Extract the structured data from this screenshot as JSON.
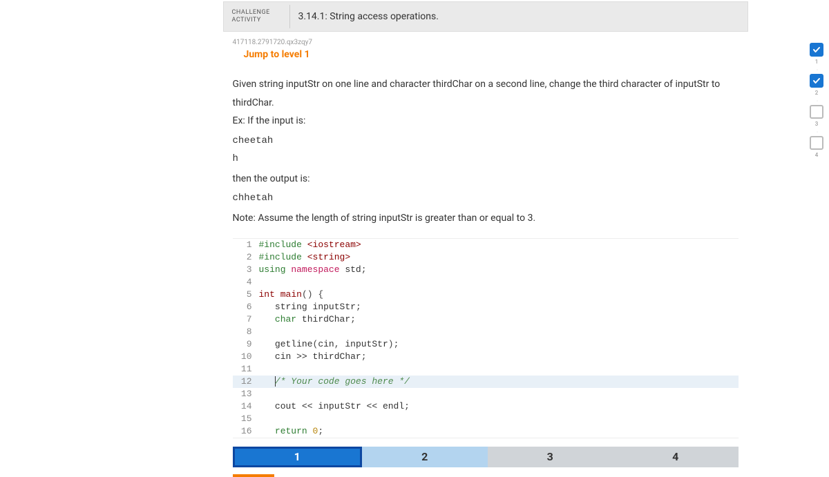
{
  "header": {
    "badge_line1": "CHALLENGE",
    "badge_line2": "ACTIVITY",
    "title": "3.14.1: String access operations."
  },
  "meta_id": "417118.2791720.qx3zqy7",
  "jump_text": "Jump to level 1",
  "prompt": {
    "p1": "Given string inputStr on one line and character thirdChar on a second line, change the third character of inputStr to thirdChar.",
    "p2": "Ex: If the input is:",
    "ex_in1": "cheetah",
    "ex_in2": "h",
    "p3": "then the output is:",
    "ex_out": "chhetah",
    "note": "Note: Assume the length of string inputStr is greater than or equal to 3."
  },
  "code": {
    "lines": [
      {
        "n": 1,
        "tokens": [
          [
            "pp",
            "#include "
          ],
          [
            "str",
            "<iostream>"
          ]
        ]
      },
      {
        "n": 2,
        "tokens": [
          [
            "pp",
            "#include "
          ],
          [
            "str",
            "<string>"
          ]
        ]
      },
      {
        "n": 3,
        "tokens": [
          [
            "kw",
            "using "
          ],
          [
            "ns",
            "namespace "
          ],
          [
            "id",
            "std"
          ],
          [
            "punc",
            ";"
          ]
        ]
      },
      {
        "n": 4,
        "tokens": []
      },
      {
        "n": 5,
        "tokens": [
          [
            "type",
            "int "
          ],
          [
            "func",
            "main"
          ],
          [
            "punc",
            "() {"
          ]
        ]
      },
      {
        "n": 6,
        "tokens": [
          [
            "id",
            "   string inputStr"
          ],
          [
            "punc",
            ";"
          ]
        ]
      },
      {
        "n": 7,
        "tokens": [
          [
            "kw",
            "   char "
          ],
          [
            "id",
            "thirdChar"
          ],
          [
            "punc",
            ";"
          ]
        ]
      },
      {
        "n": 8,
        "tokens": []
      },
      {
        "n": 9,
        "tokens": [
          [
            "id",
            "   getline"
          ],
          [
            "punc",
            "("
          ],
          [
            "id",
            "cin"
          ],
          [
            "punc",
            ", "
          ],
          [
            "id",
            "inputStr"
          ],
          [
            "punc",
            ");"
          ]
        ]
      },
      {
        "n": 10,
        "tokens": [
          [
            "id",
            "   cin "
          ],
          [
            "op",
            ">>"
          ],
          [
            "id",
            " thirdChar"
          ],
          [
            "punc",
            ";"
          ]
        ]
      },
      {
        "n": 11,
        "tokens": []
      },
      {
        "n": 12,
        "hl": true,
        "tokens": [
          [
            "id",
            "   "
          ],
          [
            "comment",
            "/* Your code goes here */"
          ]
        ]
      },
      {
        "n": 13,
        "tokens": []
      },
      {
        "n": 14,
        "tokens": [
          [
            "id",
            "   cout "
          ],
          [
            "op",
            "<<"
          ],
          [
            "id",
            " inputStr "
          ],
          [
            "op",
            "<<"
          ],
          [
            "id",
            " endl"
          ],
          [
            "punc",
            ";"
          ]
        ]
      },
      {
        "n": 15,
        "tokens": []
      },
      {
        "n": 16,
        "tokens": [
          [
            "kw",
            "   return "
          ],
          [
            "num",
            "0"
          ],
          [
            "punc",
            ";"
          ]
        ]
      }
    ]
  },
  "steps": [
    "1",
    "2",
    "3",
    "4"
  ],
  "progress": [
    {
      "n": "1",
      "done": true
    },
    {
      "n": "2",
      "done": true
    },
    {
      "n": "3",
      "done": false
    },
    {
      "n": "4",
      "done": false
    }
  ]
}
